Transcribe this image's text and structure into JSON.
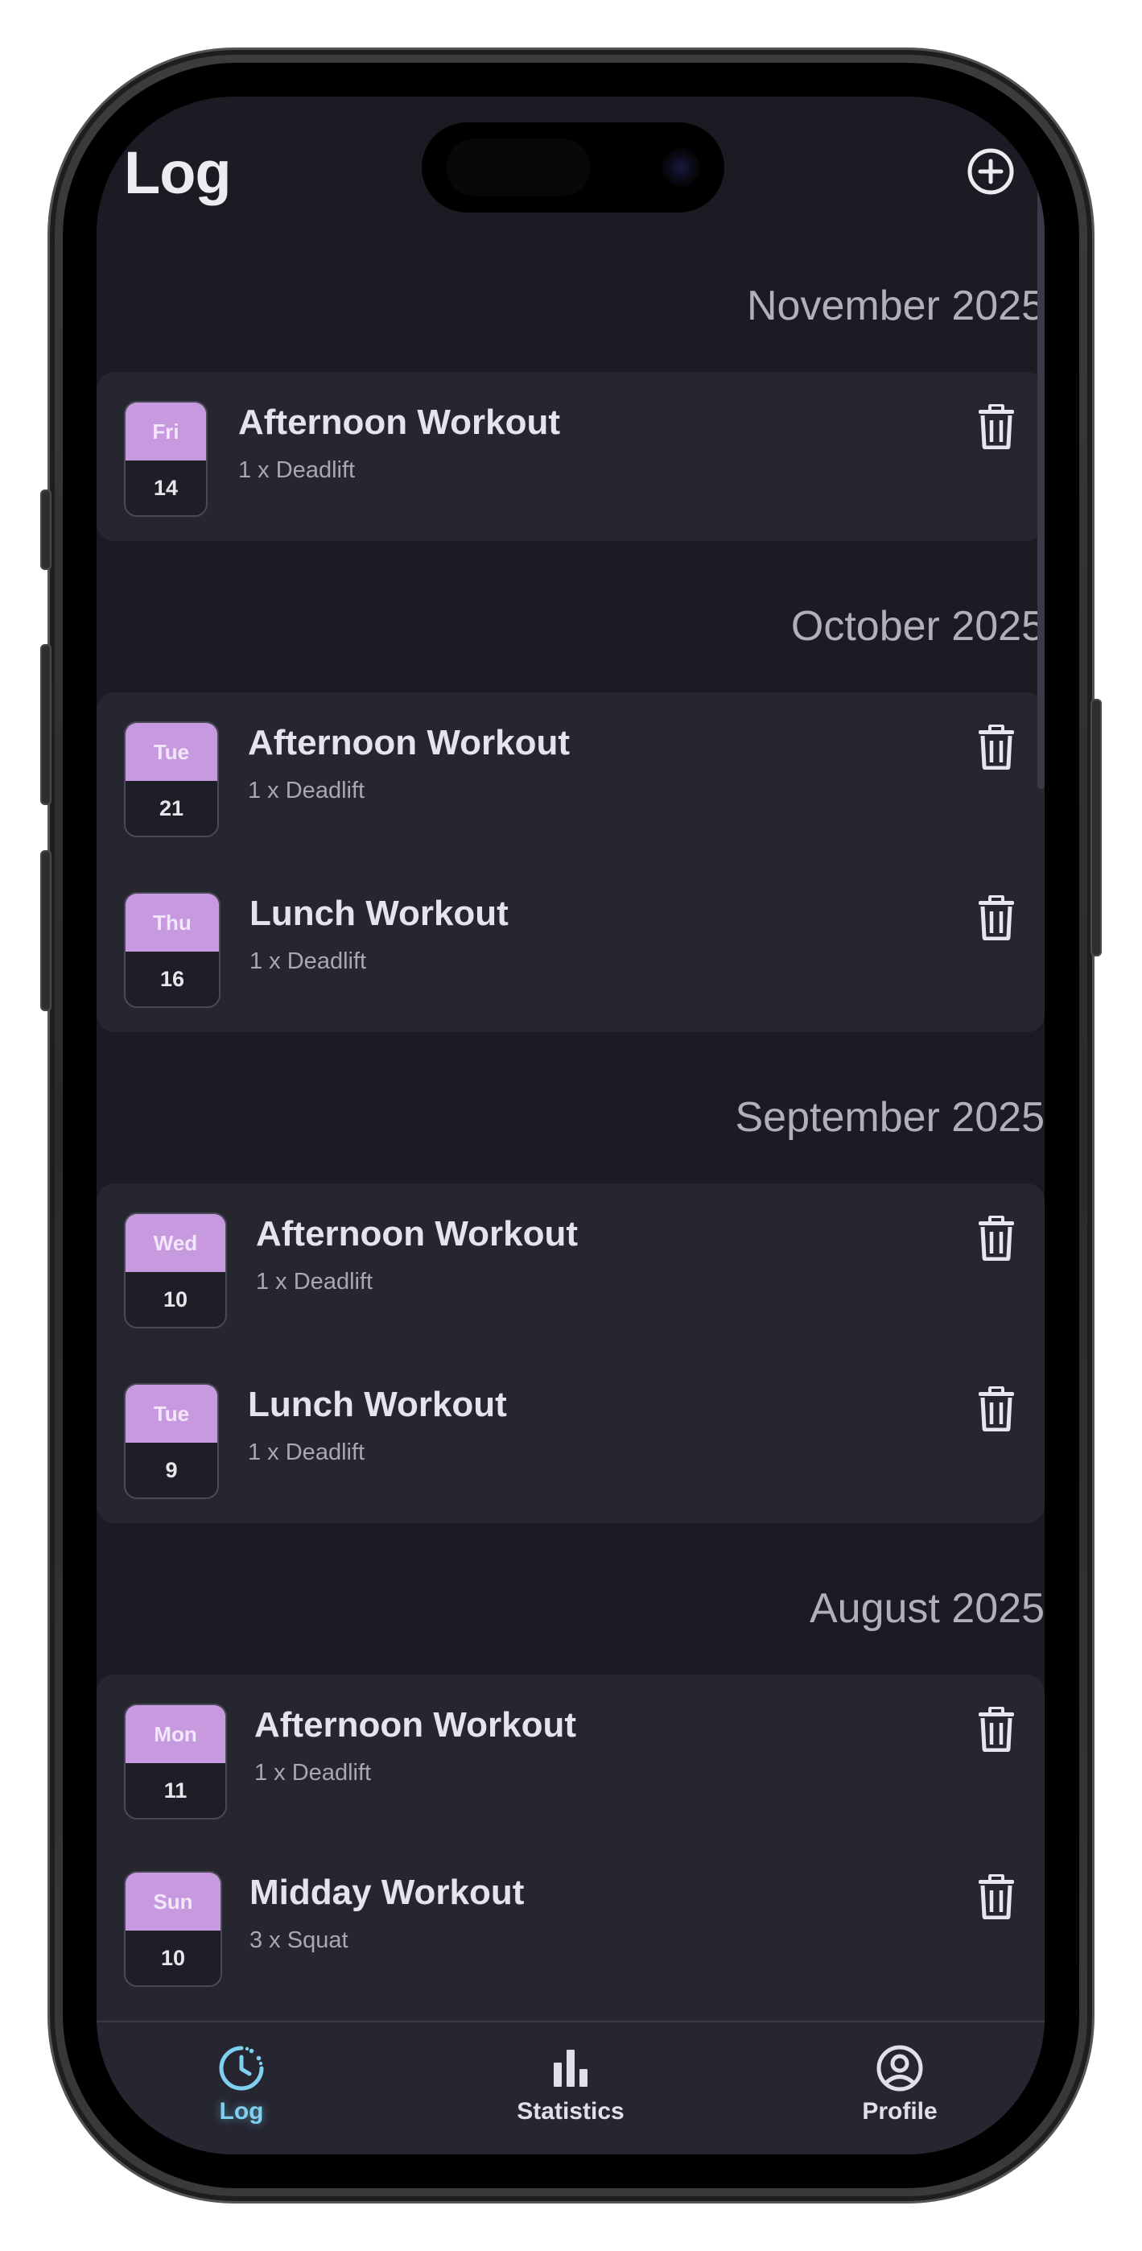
{
  "header": {
    "title": "Log"
  },
  "icons": {
    "add": "plus-circle-icon",
    "delete": "trash-icon",
    "log": "clock-history-icon",
    "statistics": "bar-chart-icon",
    "profile": "user-circle-icon"
  },
  "colors": {
    "background": "#1b1b23",
    "card": "#262631",
    "accent": "#c79ae0",
    "active_tab": "#7fcfef"
  },
  "groups": [
    {
      "month": "November 2025",
      "workouts": [
        {
          "dow": "Fri",
          "day": "14",
          "name": "Afternoon Workout",
          "summary": "1 x Deadlift"
        }
      ]
    },
    {
      "month": "October 2025",
      "workouts": [
        {
          "dow": "Tue",
          "day": "21",
          "name": "Afternoon Workout",
          "summary": "1 x Deadlift"
        },
        {
          "dow": "Thu",
          "day": "16",
          "name": "Lunch Workout",
          "summary": "1 x Deadlift"
        }
      ]
    },
    {
      "month": "September 2025",
      "workouts": [
        {
          "dow": "Wed",
          "day": "10",
          "name": "Afternoon Workout",
          "summary": "1 x Deadlift"
        },
        {
          "dow": "Tue",
          "day": "9",
          "name": "Lunch Workout",
          "summary": "1 x Deadlift"
        }
      ]
    },
    {
      "month": "August 2025",
      "workouts": [
        {
          "dow": "Mon",
          "day": "11",
          "name": "Afternoon Workout",
          "summary": "1 x Deadlift"
        },
        {
          "dow": "Sun",
          "day": "10",
          "name": "Midday Workout",
          "summary": "3 x Squat"
        }
      ]
    }
  ],
  "tabs": [
    {
      "label": "Log",
      "active": true
    },
    {
      "label": "Statistics",
      "active": false
    },
    {
      "label": "Profile",
      "active": false
    }
  ]
}
